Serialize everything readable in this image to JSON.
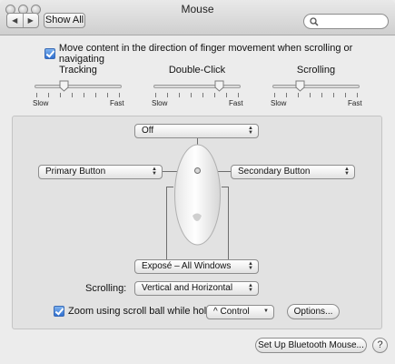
{
  "window": {
    "title": "Mouse"
  },
  "toolbar": {
    "back_icon": "back-arrow-icon",
    "forward_icon": "forward-arrow-icon",
    "show_all_label": "Show All",
    "search_placeholder": ""
  },
  "scroll_direction": {
    "label": "Move content in the direction of finger movement when scrolling or navigating",
    "checked": true
  },
  "sliders": {
    "tracking": {
      "title": "Tracking",
      "min_label": "Slow",
      "max_label": "Fast",
      "value": 0.35
    },
    "double_click": {
      "title": "Double-Click",
      "min_label": "Slow",
      "max_label": "Fast",
      "value": 0.75
    },
    "scrolling": {
      "title": "Scrolling",
      "min_label": "Slow",
      "max_label": "Fast",
      "value": 0.3
    }
  },
  "buttons": {
    "top": {
      "value": "Off"
    },
    "left": {
      "value": "Primary Button"
    },
    "right": {
      "value": "Secondary Button"
    },
    "side": {
      "value": "Exposé – All Windows"
    }
  },
  "scrolling_option": {
    "label": "Scrolling:",
    "value": "Vertical and Horizontal"
  },
  "zoom": {
    "label": "Zoom using scroll ball while holding",
    "checked": true,
    "modifier": "^ Control",
    "options_label": "Options..."
  },
  "footer": {
    "bluetooth_label": "Set Up Bluetooth Mouse...",
    "help_label": "?"
  },
  "colors": {
    "accent": "#3b78d8",
    "background": "#ececec",
    "panel": "#e2e2e2"
  }
}
